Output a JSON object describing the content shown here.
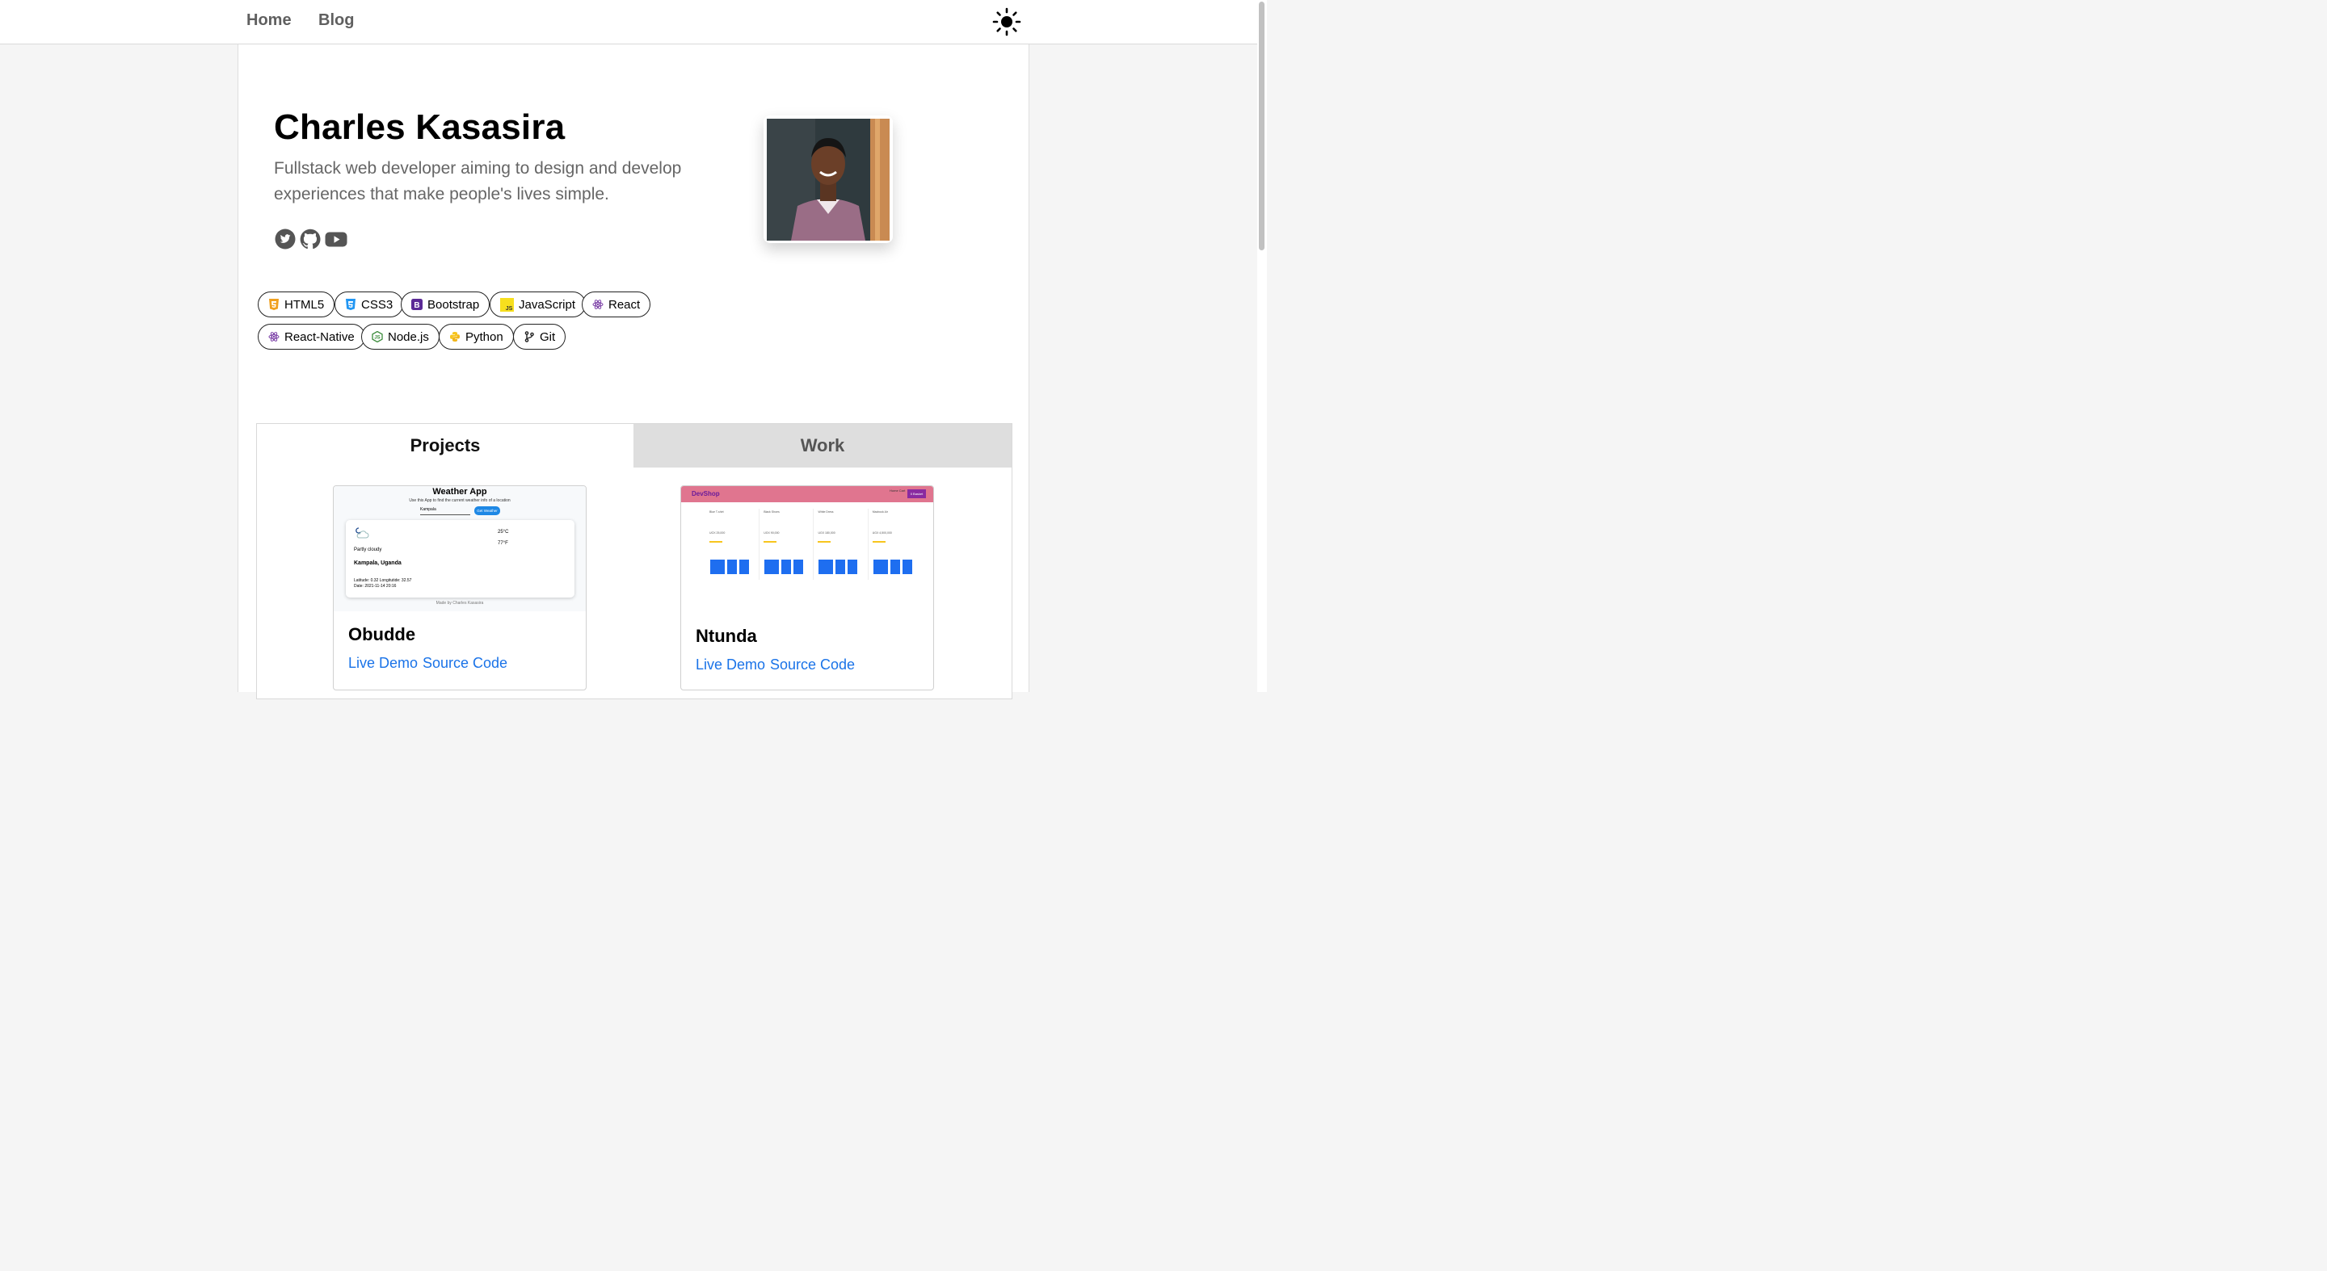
{
  "nav": {
    "home": "Home",
    "blog": "Blog"
  },
  "profile": {
    "name": "Charles Kasasira",
    "tagline": "Fullstack web developer aiming to design and develop experiences that make people's lives simple."
  },
  "social_icons": [
    "twitter-icon",
    "github-icon",
    "youtube-icon"
  ],
  "skills": [
    {
      "label": "HTML5",
      "color": "#f0a01e"
    },
    {
      "label": "CSS3",
      "color": "#2196f3"
    },
    {
      "label": "Bootstrap",
      "color": "#5b2a96"
    },
    {
      "label": "JavaScript",
      "color": "#f7df1e"
    },
    {
      "label": "React",
      "color": "#7b3fa6"
    },
    {
      "label": "React-Native",
      "color": "#7b3fa6"
    },
    {
      "label": "Node.js",
      "color": "#3c8c3c"
    },
    {
      "label": "Python",
      "color": "#f7c51e"
    },
    {
      "label": "Git",
      "color": "#222222"
    }
  ],
  "tabs": {
    "projects": "Projects",
    "work": "Work"
  },
  "projects": [
    {
      "title": "Obudde",
      "live": "Live Demo",
      "source": "Source Code",
      "preview": {
        "app_title": "Weather App",
        "subtitle": "Use this App to find the current weather info of a location",
        "input_value": "Kampala",
        "button": "Get Weather",
        "temp_c": "25°C",
        "temp_f": "77°F",
        "condition": "Partly cloudy",
        "location": "Kampala, Uganda",
        "coords": "Latitude: 0.32  Longitutide: 32.57",
        "date": "Date: 2021-11-14 20:16",
        "footer": "Made by Charles Kasasira"
      }
    },
    {
      "title": "Ntunda",
      "live": "Live Demo",
      "source": "Source Code",
      "preview": {
        "brand": "DevShop",
        "nav_links": "Home  Cart",
        "basket": "0 Basket",
        "items": [
          {
            "name": "Blue T-shirt",
            "price": "UGX 25,000"
          },
          {
            "name": "Black Shoes",
            "price": "UGX 90,000"
          },
          {
            "name": "White Dress",
            "price": "UGX 180,000"
          },
          {
            "name": "Macbook Air",
            "price": "UGX 4,500,000"
          }
        ]
      }
    }
  ],
  "colors": {
    "link": "#1a73e8",
    "devshop_header": "#e0758f",
    "weather_button": "#1e88e5"
  }
}
